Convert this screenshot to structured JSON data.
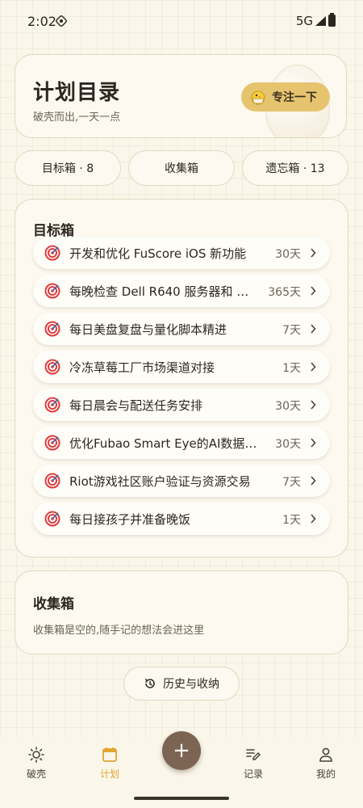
{
  "status_bar": {
    "time": "2:02",
    "network": "5G"
  },
  "header": {
    "title": "计划目录",
    "subtitle": "破壳而出,一天一点",
    "focus_button": "专注一下"
  },
  "tabs": [
    {
      "label": "目标箱 · 8"
    },
    {
      "label": "收集箱"
    },
    {
      "label": "遗忘箱 · 13"
    }
  ],
  "goal_box": {
    "title": "目标箱",
    "items": [
      {
        "text": "开发和优化 FuScore iOS 新功能",
        "days": "30天"
      },
      {
        "text": "每晚检查 Dell R640 服务器和 …",
        "days": "365天"
      },
      {
        "text": "每日美盘复盘与量化脚本精进",
        "days": "7天"
      },
      {
        "text": "冷冻草莓工厂市场渠道对接",
        "days": "1天"
      },
      {
        "text": "每日晨会与配送任务安排",
        "days": "30天"
      },
      {
        "text": "优化Fubao Smart Eye的AI数据…",
        "days": "30天"
      },
      {
        "text": "Riot游戏社区账户验证与资源交易",
        "days": "7天"
      },
      {
        "text": "每日接孩子并准备晚饭",
        "days": "1天"
      }
    ]
  },
  "collect_box": {
    "title": "收集箱",
    "empty_text": "收集箱是空的,随手记的想法会进这里"
  },
  "history_button": "历史与收纳",
  "bottom_nav": [
    {
      "label": "破壳",
      "icon": "sun-icon"
    },
    {
      "label": "计划",
      "icon": "calendar-icon",
      "active": true
    },
    {
      "label": "记录",
      "icon": "edit-list-icon"
    },
    {
      "label": "我的",
      "icon": "person-icon"
    }
  ],
  "fab_label": "+",
  "colors": {
    "accent": "#e0a531",
    "button_bg": "#e6c46f",
    "fab": "#7b6452",
    "target_red": "#e23a3a"
  }
}
